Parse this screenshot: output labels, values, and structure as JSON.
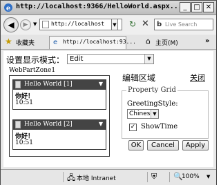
{
  "window": {
    "title": "http://localhost:9366/HelloWorld.aspx...",
    "minimize": "_",
    "maximize": "□",
    "close": "✕"
  },
  "navbar": {
    "address": "http://localhost ",
    "search_placeholder": "Live Search"
  },
  "favorites": {
    "label": "收藏夹",
    "tab_title": "http://localhost:93...",
    "home_label": "主页(M)"
  },
  "page": {
    "mode_label": "设置显示模式：",
    "mode_value": "Edit",
    "zone_label": "WebPartZone1",
    "parts": [
      {
        "title": "Hello World [1]",
        "greeting": "你好！",
        "time": "10:51"
      },
      {
        "title": "Hello World [2]",
        "greeting": "你好！",
        "time": "10:51"
      }
    ],
    "editor": {
      "title": "编辑区域",
      "close": "关闭",
      "legend": "Property Grid",
      "greeting_style_label": "GreetingStyle:",
      "greeting_style_value": "Chinese",
      "show_time_label": "ShowTime",
      "show_time_checked": true,
      "ok": "OK",
      "cancel": "Cancel",
      "apply": "Apply"
    }
  },
  "statusbar": {
    "zone": "本地 Intranet",
    "zoom": "100%"
  }
}
